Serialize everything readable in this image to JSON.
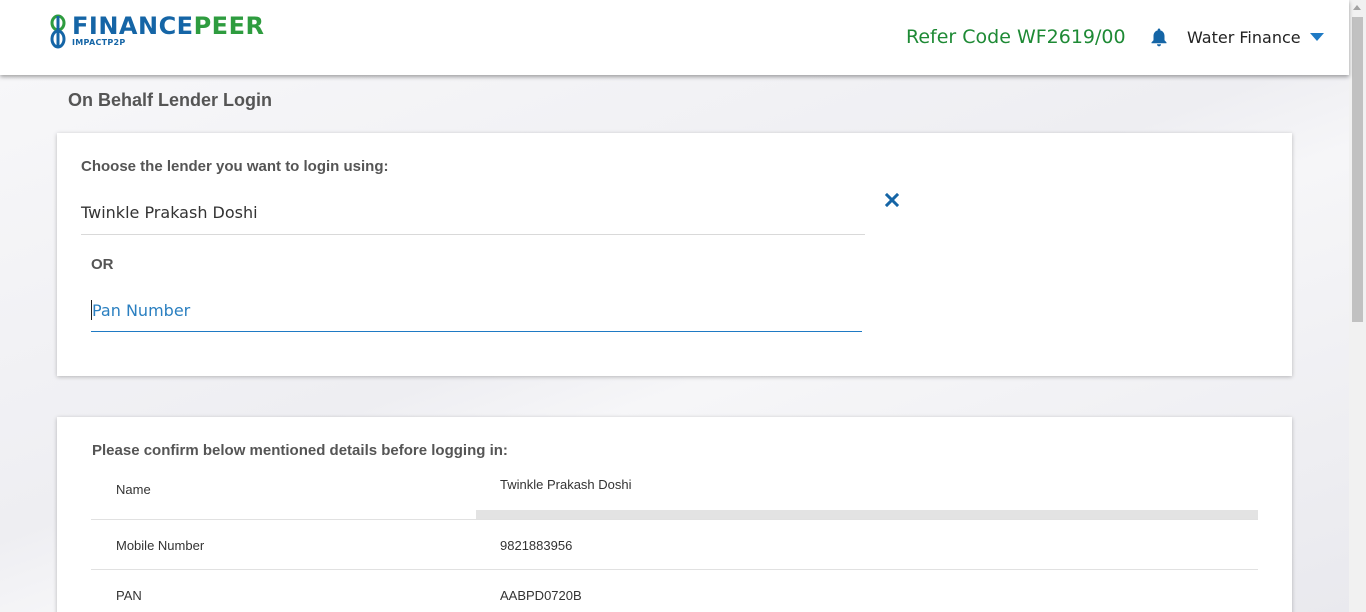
{
  "header": {
    "logo_primary": "FINANCE",
    "logo_secondary": "PEER",
    "logo_tagline": "IMPACTP2P",
    "refer_code": "Refer Code WF2619/00",
    "user_name": "Water Finance"
  },
  "page": {
    "title": "On Behalf Lender Login"
  },
  "lender_selection": {
    "prompt": "Choose the lender you want to login using:",
    "selected_lender": "Twinkle Prakash Doshi",
    "or_label": "OR",
    "pan_placeholder": "Pan Number",
    "pan_value": ""
  },
  "confirmation": {
    "prompt": "Please confirm below mentioned details before logging in:",
    "rows": [
      {
        "label": "Name",
        "value": "Twinkle Prakash Doshi"
      },
      {
        "label": "Mobile Number",
        "value": "9821883956"
      },
      {
        "label": "PAN",
        "value": "AABPD0720B"
      }
    ]
  },
  "colors": {
    "brand_blue": "#1565a6",
    "brand_green": "#2e9c3f",
    "refer_green": "#1e8a35",
    "focus_blue": "#1f7ac4"
  },
  "icons": {
    "bell": "bell-icon",
    "caret": "caret-down-icon",
    "clear": "close-icon"
  }
}
